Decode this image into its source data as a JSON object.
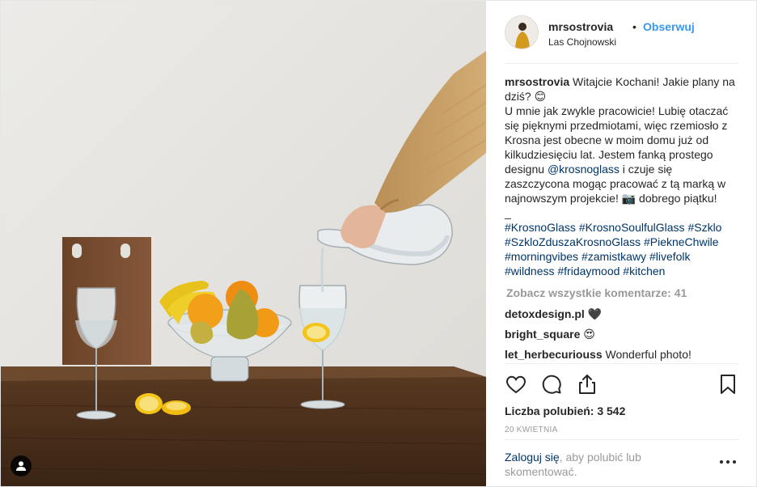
{
  "post": {
    "username": "mrsostrovia",
    "separator": "•",
    "follow_label": "Obserwuj",
    "location": "Las Chojnowski",
    "caption": {
      "username": "mrsostrovia",
      "part1": "Witajcie Kochani! Jakie plany na dziś? 😊",
      "part2": "U mnie jak zwykle pracowicie! Lubię otaczać się pięknymi przedmiotami, więc rzemiosło z Krosna jest obecne w moim domu już od kilkudziesięciu lat. Jestem fanką prostego designu ",
      "mention": "@krosnoglass",
      "part3": " i czuje się zaszczycona mogąc pracować z tą marką w najnowszym projekcie! 📷 dobrego piątku!",
      "dash": "_"
    },
    "hashtags": "#KrosnoGlass #KrosnoSoulfulGlass #Szklo #SzkloZduszaKrosnoGlass #PiekneChwile #morningvibes #zamistkawy #livefolk #wildness #fridaymood #kitchen",
    "view_all_comments": "Zobacz wszystkie komentarze: 41",
    "comments": [
      {
        "user": "detoxdesign.pl",
        "text": "🖤"
      },
      {
        "user": "bright_square",
        "text": "😍"
      },
      {
        "user": "let_herbecuriouss",
        "text": "Wonderful photo!"
      }
    ],
    "likes": "Liczba polubień: 3 542",
    "date": "20 KWIETNIA",
    "login_link": "Zaloguj się",
    "login_rest": ", aby polubić lub skomentować."
  },
  "icons": {
    "like": "heart-icon",
    "comment": "comment-icon",
    "share": "share-icon",
    "save": "bookmark-icon",
    "more": "more-dots-icon",
    "tag": "user-tag-icon"
  }
}
